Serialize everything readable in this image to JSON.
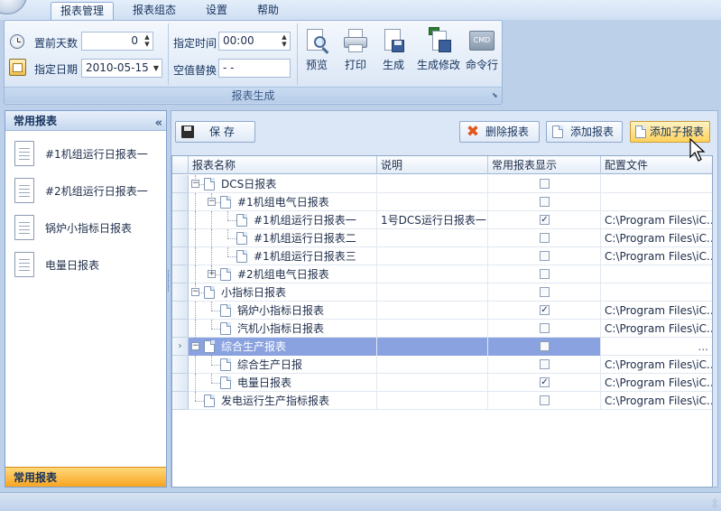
{
  "tabs": [
    {
      "label": "报表管理",
      "active": true
    },
    {
      "label": "报表组态"
    },
    {
      "label": "设置"
    },
    {
      "label": "帮助"
    }
  ],
  "ribbon": {
    "days_before_label": "置前天数",
    "days_before_value": "0",
    "date_label": "指定日期",
    "date_value": "2010-05-15",
    "time_label": "指定时间",
    "time_value": "00:00",
    "null_replace_label": "空值替换",
    "null_replace_value": "- -",
    "buttons": {
      "preview": "预览",
      "print": "打印",
      "generate": "生成",
      "generate_edit": "生成修改",
      "command": "命令行"
    },
    "cmd_icon_text": "CMD",
    "group_title": "报表生成"
  },
  "sidebar": {
    "title": "常用报表",
    "collapse_glyph": "«",
    "items": [
      {
        "label": "#1机组运行日报表一"
      },
      {
        "label": "#2机组运行日报表一"
      },
      {
        "label": "锅炉小指标日报表"
      },
      {
        "label": "电量日报表"
      }
    ],
    "footer": "常用报表"
  },
  "toolbar": {
    "save": "保  存",
    "delete": "删除报表",
    "add": "添加报表",
    "add_child": "添加子报表"
  },
  "grid": {
    "columns": [
      "报表名称",
      "说明",
      "常用报表显示",
      "配置文件"
    ],
    "rows": [
      {
        "name": "DCS日报表",
        "desc": "",
        "checked": false,
        "config": ""
      },
      {
        "name": "#1机组电气日报表",
        "desc": "",
        "checked": false,
        "config": ""
      },
      {
        "name": "#1机组运行日报表一",
        "desc": "1号DCS运行日报表一",
        "checked": true,
        "config": "C:\\Program Files\\iC..."
      },
      {
        "name": "#1机组运行日报表二",
        "desc": "",
        "checked": false,
        "config": "C:\\Program Files\\iC..."
      },
      {
        "name": "#1机组运行日报表三",
        "desc": "",
        "checked": false,
        "config": "C:\\Program Files\\iC..."
      },
      {
        "name": "#2机组电气日报表",
        "desc": "",
        "checked": false,
        "config": ""
      },
      {
        "name": "小指标日报表",
        "desc": "",
        "checked": false,
        "config": ""
      },
      {
        "name": "锅炉小指标日报表",
        "desc": "",
        "checked": true,
        "config": "C:\\Program Files\\iC..."
      },
      {
        "name": "汽机小指标日报表",
        "desc": "",
        "checked": false,
        "config": "C:\\Program Files\\iC..."
      },
      {
        "name": "综合生产报表",
        "desc": "",
        "checked": false,
        "config": "...",
        "selected": true
      },
      {
        "name": "综合生产日报",
        "desc": "",
        "checked": false,
        "config": "C:\\Program Files\\iC..."
      },
      {
        "name": "电量日报表",
        "desc": "",
        "checked": true,
        "config": "C:\\Program Files\\iC..."
      },
      {
        "name": "发电运行生产指标报表",
        "desc": "",
        "checked": false,
        "config": "C:\\Program Files\\iC..."
      }
    ]
  },
  "colors": {
    "selection": "#8aa2df",
    "sidebar_footer": "#f7a422",
    "hot_button": "#ffd25a"
  }
}
